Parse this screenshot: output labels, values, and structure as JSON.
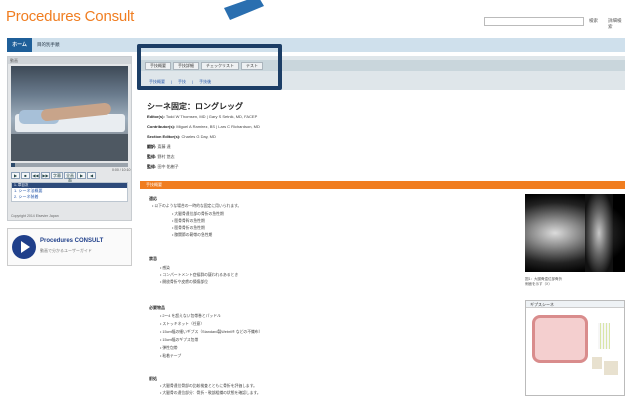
{
  "header": {
    "app_title": "Procedures Consult",
    "search_button": "検索",
    "lang_link": "詳細検索"
  },
  "nav": {
    "home": "ホーム",
    "item": "目的別手順"
  },
  "left_panel": {
    "head": "動画",
    "video_progress": 0.03,
    "timecode": "0:00 / 10:10",
    "controls": [
      "▶",
      "■",
      "◀◀",
      "▶▶",
      "字幕",
      "全画面",
      "▶",
      "◀"
    ],
    "chapters_head": "1. 章目次",
    "chapters": [
      "1. シーネ法概要",
      "2. シーネ装着"
    ],
    "copyright": "Copyright 2014 Elsevier Japan"
  },
  "promo": {
    "title": "Procedures CONSULT",
    "subtitle": "動画で分かるユーザーガイド"
  },
  "tabs": [
    "手技概要",
    "手技詳細",
    "チェックリスト",
    "テスト"
  ],
  "subtabs": [
    "手技概要",
    "手技",
    "手技後"
  ],
  "procedure": {
    "title": "シーネ固定：ロングレッグ",
    "editors_label": "Editor(s):",
    "editors": "Todd W Thomsen, MD  |  Gary S Setnik, MD, FACEP",
    "contributors_label": "Contributor(s):",
    "contributors": "Miguel A Ramirez, BS  |  Lars C Richardson, MD",
    "section_editors_label": "Section Editor(s):",
    "section_editors": "Charles G Day, MD",
    "translation_label": "翻訳:",
    "translation": "斎藤 達",
    "supervision_label": "監修:",
    "supervision": "野村 悠志",
    "proofread_label": "監修:",
    "proofread": "田中 佑樹子"
  },
  "section_bar": "手技概要",
  "content": {
    "indications_head": "適応",
    "indications_intro": "以下のような場合の一時的な固定に用いられます。",
    "indications": [
      "大腿骨遠位部の骨折の急性期",
      "脛骨骨幹の急性期",
      "脛骨骨折の急性期",
      "膝関節の靭帯の急性期"
    ],
    "contra_head": "禁忌",
    "contra": [
      "感染",
      "コンパートメント症候群の疑われるあるとき",
      "開放骨折や皮膚の損傷部位"
    ],
    "materials_head": "必要物品",
    "materials": [
      "2〜4 を超えない包帯巻とパッドル",
      "ストッキネット（任意）",
      "15cm幅の細いギプス（Standard製Webril® などの不織布）",
      "15cm幅のギプス包帯",
      "弾性包帯",
      "粘着テープ"
    ],
    "steps_head": "前処",
    "steps": [
      "大腿骨遠位骨部の比較検査とともに骨折を評価します。",
      "大腿骨の遠位部分：骨折・軟部組織の状態を確認します。"
    ]
  },
  "xray": {
    "caption": "図1：大腿骨遠位部骨折",
    "caption2": "側面を示す（X）"
  },
  "kit": {
    "head": "ギプスシーネ"
  },
  "colors": {
    "brand_orange": "#f07d20",
    "nav_blue": "#1f5f99",
    "highlight": "#1c3e66",
    "arrow": "#2a6fb0"
  }
}
